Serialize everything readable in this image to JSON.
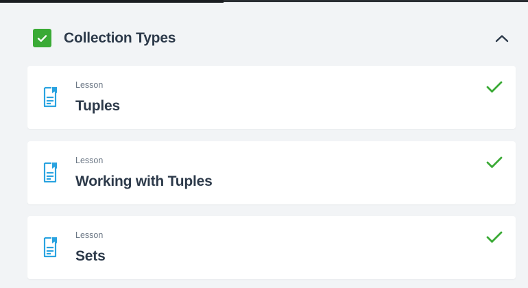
{
  "section": {
    "title": "Collection Types",
    "completed": true,
    "expanded": true,
    "colors": {
      "complete_green": "#3aaa35",
      "icon_blue": "#2aa3e0",
      "title": "#2d3a4a"
    }
  },
  "lessons": [
    {
      "type": "Lesson",
      "title": "Tuples",
      "icon": "document-icon",
      "status_icon": "checkmark-icon"
    },
    {
      "type": "Lesson",
      "title": "Working with Tuples",
      "icon": "document-icon",
      "status_icon": "checkmark-icon"
    },
    {
      "type": "Lesson",
      "title": "Sets",
      "icon": "document-icon",
      "status_icon": "checkmark-icon"
    }
  ]
}
